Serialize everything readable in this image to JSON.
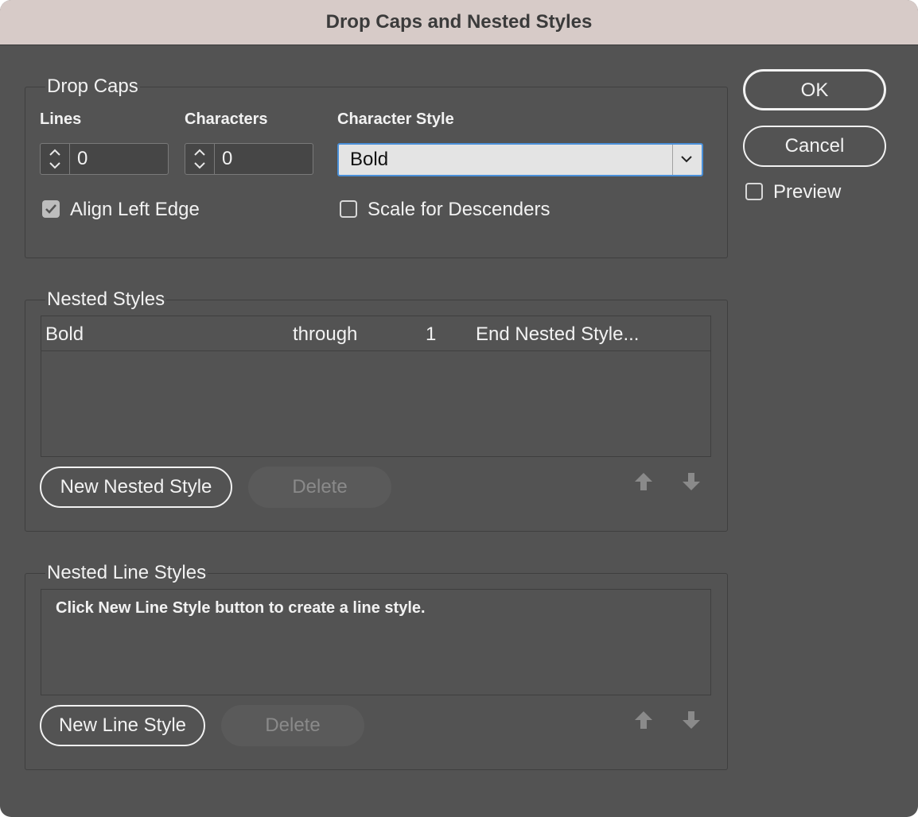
{
  "window": {
    "title": "Drop Caps and Nested Styles"
  },
  "drop_caps": {
    "legend": "Drop Caps",
    "lines": {
      "label": "Lines",
      "value": "0"
    },
    "characters": {
      "label": "Characters",
      "value": "0"
    },
    "character_style": {
      "label": "Character Style",
      "value": "Bold"
    },
    "align_left_edge": {
      "label": "Align Left Edge",
      "checked": true
    },
    "scale_for_descenders": {
      "label": "Scale for Descenders",
      "checked": false
    }
  },
  "buttons": {
    "ok": "OK",
    "cancel": "Cancel",
    "preview": {
      "label": "Preview",
      "checked": false
    }
  },
  "nested_styles": {
    "legend": "Nested Styles",
    "rows": [
      {
        "style": "Bold",
        "mode": "through",
        "count": "1",
        "until": "End Nested Style..."
      }
    ],
    "new_button": "New Nested Style",
    "delete_button": "Delete"
  },
  "nested_line_styles": {
    "legend": "Nested Line Styles",
    "hint": "Click New Line Style button to create a line style.",
    "new_button": "New Line Style",
    "delete_button": "Delete"
  },
  "icons": [
    "stepper-arrows-icon",
    "chevron-down-icon",
    "checkmark-icon",
    "arrow-up-icon",
    "arrow-down-icon"
  ]
}
